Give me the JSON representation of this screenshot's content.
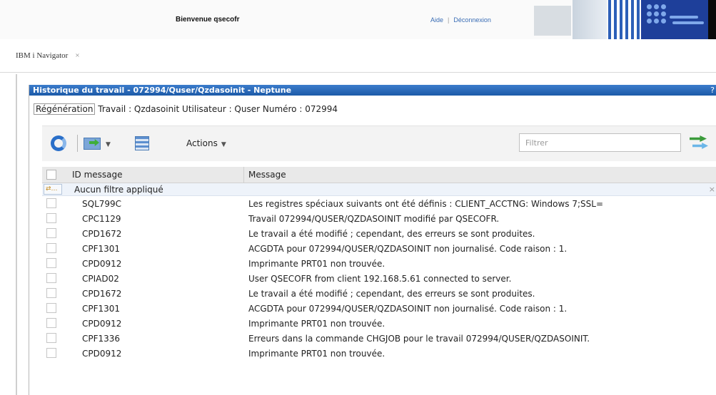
{
  "header": {
    "welcome": "Bienvenue qsecofr",
    "help_link": "Aide",
    "separator": "|",
    "logout_link": "Déconnexion"
  },
  "tabs": [
    {
      "label": "IBM i Navigator",
      "close": "×"
    }
  ],
  "panel": {
    "title": "Historique du travail - 072994/Quser/Qzdasoinit - Neptune",
    "help": "?",
    "refresh_label": "Régénération",
    "info": "Travail : Qzdasoinit Utilisateur : Quser Numéro : 072994"
  },
  "toolbar": {
    "actions_label": "Actions",
    "dropdown_glyph": "▼",
    "filter_placeholder": "Filtrer"
  },
  "table": {
    "columns": [
      "ID message",
      "Message"
    ],
    "filter_status": "Aucun filtre appliqué",
    "filter_icon_text": "⇄…",
    "filter_clear": "×",
    "rows": [
      {
        "id": "SQL799C",
        "message": "Les registres spéciaux suivants ont été définis : CLIENT_ACCTNG: Windows 7;SSL="
      },
      {
        "id": "CPC1129",
        "message": "Travail 072994/QUSER/QZDASOINIT modifié par QSECOFR."
      },
      {
        "id": "CPD1672",
        "message": "Le travail a été modifié ; cependant, des erreurs se sont produites."
      },
      {
        "id": "CPF1301",
        "message": "ACGDTA pour 072994/QUSER/QZDASOINIT non journalisé. Code raison : 1."
      },
      {
        "id": "CPD0912",
        "message": "Imprimante PRT01 non trouvée."
      },
      {
        "id": "CPIAD02",
        "message": "User QSECOFR from client 192.168.5.61 connected to server."
      },
      {
        "id": "CPD1672",
        "message": "Le travail a été modifié ; cependant, des erreurs se sont produites."
      },
      {
        "id": "CPF1301",
        "message": "ACGDTA pour 072994/QUSER/QZDASOINIT non journalisé. Code raison : 1."
      },
      {
        "id": "CPD0912",
        "message": "Imprimante PRT01 non trouvée."
      },
      {
        "id": "CPF1336",
        "message": "Erreurs dans la commande CHGJOB pour le travail 072994/QUSER/QZDASOINIT."
      },
      {
        "id": "CPD0912",
        "message": "Imprimante PRT01 non trouvée."
      }
    ]
  }
}
